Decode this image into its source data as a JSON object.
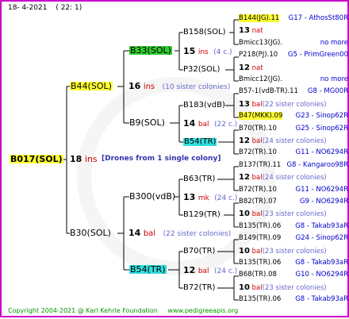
{
  "header": {
    "date": "18-  4-2021",
    "count": "( 22:  1)"
  },
  "root": {
    "name": "B017(SOL)",
    "gen_num": "18",
    "gen_unit": "ins",
    "drones": "[Drones from 1 single colony]"
  },
  "gen1": {
    "top": {
      "name": "B44(SOL)",
      "num": "16",
      "unit": "ins",
      "note": "(10 sister colonies)"
    },
    "bottom": {
      "name": "B30(SOL)",
      "num": "14",
      "unit": "bal",
      "note": "(22 sister colonies)"
    }
  },
  "gen2": {
    "a": {
      "name": "B33(SOL)",
      "num": "15",
      "unit": "ins",
      "note": "(4 c.)"
    },
    "b": {
      "name": "B9(SOL)",
      "num": "14",
      "unit": "bal",
      "note": "(22 c.)"
    },
    "c": {
      "name": "B300(vdB)",
      "num": "13",
      "unit": "mk",
      "note": "(24 c.)"
    },
    "d": {
      "name": "B54(TR)",
      "num": "12",
      "unit": "bal",
      "note": "(24 c.)"
    }
  },
  "gen3": {
    "a1": "B158(SOL)",
    "a2": "P32(SOL)",
    "b1": "B183(vdB)",
    "b2": "B54(TR)",
    "c1": "B63(TR)",
    "c2": "B129(TR)",
    "d1": "B70(TR)",
    "d2": "B72(TR)"
  },
  "gen4": [
    {
      "left": "B144(JG).11",
      "right": "G17 - AthosSt80R"
    },
    {
      "num": "13",
      "unit": "nat"
    },
    {
      "left": "Bmicc13(JG).",
      "right": "no more"
    },
    {
      "left": "P218(PJ).10",
      "right": "G5 - PrimGreen00"
    },
    {
      "num": "12",
      "unit": "nat"
    },
    {
      "left": "Bmicc12(JG).",
      "right": "no more"
    },
    {
      "left": "B57-1(vdB-TR).11",
      "right": "G8 - MG00R"
    },
    {
      "num": "13",
      "unit": "bal",
      "note": "(22 sister colonies)"
    },
    {
      "left": "B47(MKK).09",
      "right": "G23 - Sinop62R"
    },
    {
      "left": "B70(TR).10",
      "right": "G25 - Sinop62R"
    },
    {
      "num": "12",
      "unit": "bal",
      "note": "(24 sister colonies)"
    },
    {
      "left": "B72(TR).10",
      "right": "G11 - NO6294R"
    },
    {
      "left": "B137(TR).11",
      "right": "G8 - Kangaroo98R"
    },
    {
      "num": "12",
      "unit": "bal",
      "note": "(24 sister colonies)"
    },
    {
      "left": "B72(TR).10",
      "right": "G11 - NO6294R"
    },
    {
      "left": "B82(TR).07",
      "right": "G9 - NO6294R"
    },
    {
      "num": "10",
      "unit": "bal",
      "note": "(23 sister colonies)"
    },
    {
      "left": "B135(TR).06",
      "right": "G8 - Takab93aR"
    },
    {
      "left": "B149(TR).09",
      "right": "G24 - Sinop62R"
    },
    {
      "num": "10",
      "unit": "bal",
      "note": "(23 sister colonies)"
    },
    {
      "left": "B135(TR).06",
      "right": "G8 - Takab93aR"
    },
    {
      "left": "B68(TR).08",
      "right": "G10 - NO6294R"
    },
    {
      "num": "10",
      "unit": "bal",
      "note": "(23 sister colonies)"
    },
    {
      "left": "B135(TR).06",
      "right": "G8 - Takab93aR"
    }
  ],
  "footer": {
    "copyright": "Copyright 2004-2021 @ Karl Kehrle Foundation",
    "site": "www.pedigreeapis.org"
  }
}
